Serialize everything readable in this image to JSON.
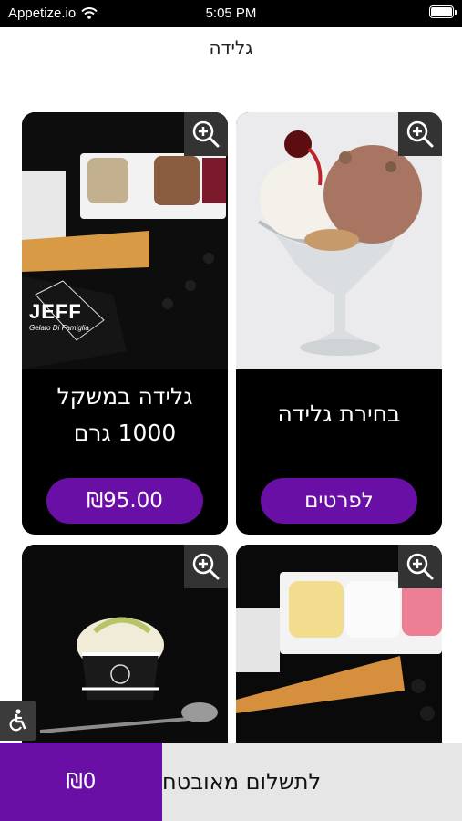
{
  "status_bar": {
    "carrier": "Appetize.io",
    "time": "5:05 PM"
  },
  "page": {
    "title": "גלידה"
  },
  "products": [
    {
      "name": "בחירת גלידה",
      "button": "לפרטים"
    },
    {
      "name": "גלידה במשקל 1000 גרם",
      "button": "₪95.00"
    },
    {
      "name": "",
      "button": ""
    },
    {
      "name": "",
      "button": ""
    }
  ],
  "logo_text": {
    "brand": "JEFF",
    "tagline": "Gelato Di Famiglia"
  },
  "bottom_bar": {
    "checkout": "לתשלום מאובטח",
    "total": "₪0"
  },
  "colors": {
    "accent": "#6a0fa5",
    "card_bg": "#000000",
    "zoom_bg": "#333333"
  },
  "icons": {
    "zoom": "zoom-in-icon",
    "accessibility": "accessibility-icon",
    "wifi": "wifi-icon",
    "battery": "battery-icon"
  }
}
